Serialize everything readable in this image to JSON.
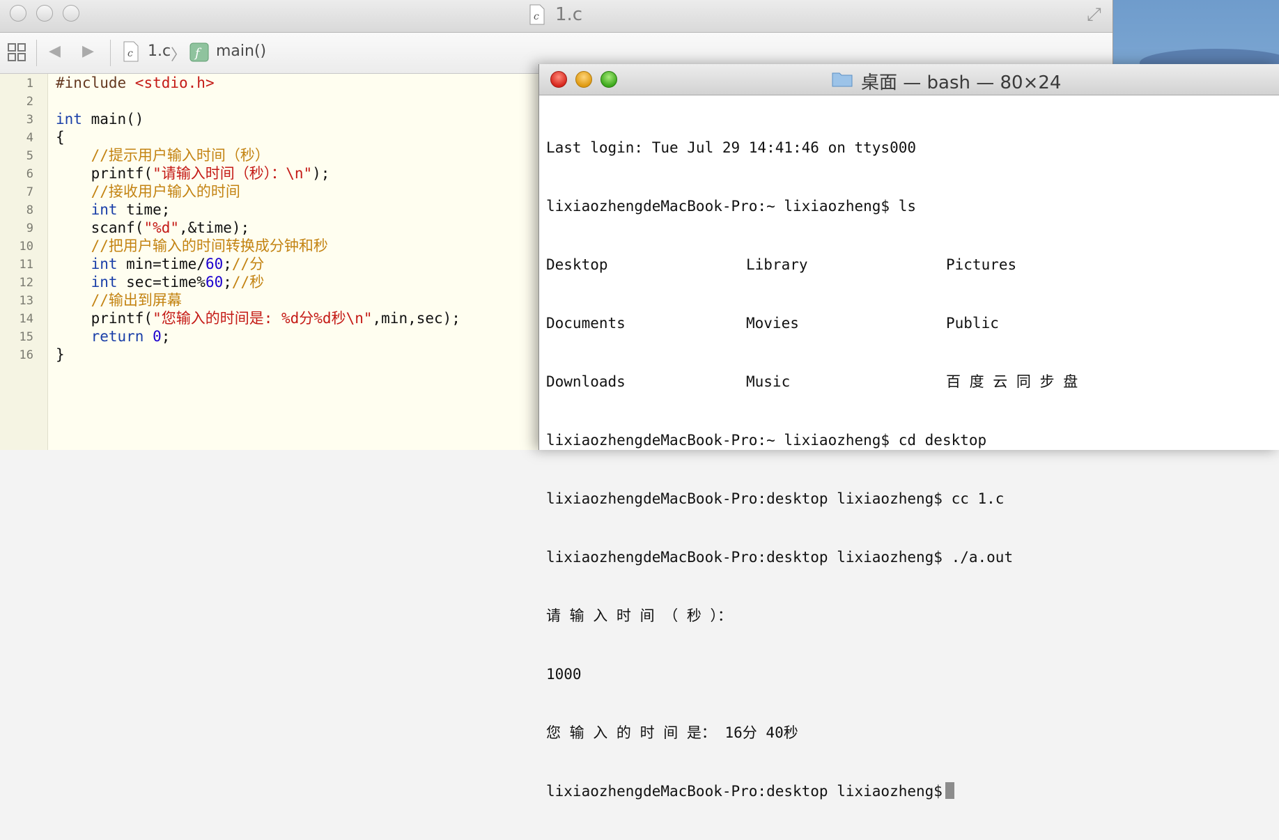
{
  "xcode": {
    "window_title": "1.c",
    "jump_bar": {
      "file": "1.c",
      "separator": "〉",
      "function": "main()"
    },
    "line_numbers": [
      "1",
      "2",
      "3",
      "4",
      "5",
      "6",
      "7",
      "8",
      "9",
      "10",
      "11",
      "12",
      "13",
      "14",
      "15",
      "16"
    ],
    "code_lines": [
      [
        {
          "t": "#include ",
          "c": "pp"
        },
        {
          "t": "<stdio.h>",
          "c": "str"
        }
      ],
      [],
      [
        {
          "t": "int",
          "c": "kw"
        },
        {
          "t": " main()",
          "c": ""
        }
      ],
      [
        {
          "t": "{",
          "c": ""
        }
      ],
      [
        {
          "t": "    ",
          "c": ""
        },
        {
          "t": "//提示用户输入时间（秒）",
          "c": "cm"
        }
      ],
      [
        {
          "t": "    printf(",
          "c": ""
        },
        {
          "t": "\"请输入时间（秒）：\\n\"",
          "c": "str"
        },
        {
          "t": ");",
          "c": ""
        }
      ],
      [
        {
          "t": "    ",
          "c": ""
        },
        {
          "t": "//接收用户输入的时间",
          "c": "cm"
        }
      ],
      [
        {
          "t": "    ",
          "c": ""
        },
        {
          "t": "int",
          "c": "kw"
        },
        {
          "t": " time;",
          "c": ""
        }
      ],
      [
        {
          "t": "    scanf(",
          "c": ""
        },
        {
          "t": "\"%d\"",
          "c": "str"
        },
        {
          "t": ",&time);",
          "c": ""
        }
      ],
      [
        {
          "t": "    ",
          "c": ""
        },
        {
          "t": "//把用户输入的时间转换成分钟和秒",
          "c": "cm"
        }
      ],
      [
        {
          "t": "    ",
          "c": ""
        },
        {
          "t": "int",
          "c": "kw"
        },
        {
          "t": " min=time/",
          "c": ""
        },
        {
          "t": "60",
          "c": "num"
        },
        {
          "t": ";",
          "c": ""
        },
        {
          "t": "//分",
          "c": "cm"
        }
      ],
      [
        {
          "t": "    ",
          "c": ""
        },
        {
          "t": "int",
          "c": "kw"
        },
        {
          "t": " sec=time%",
          "c": ""
        },
        {
          "t": "60",
          "c": "num"
        },
        {
          "t": ";",
          "c": ""
        },
        {
          "t": "//秒",
          "c": "cm"
        }
      ],
      [
        {
          "t": "    ",
          "c": ""
        },
        {
          "t": "//输出到屏幕",
          "c": "cm"
        }
      ],
      [
        {
          "t": "    printf(",
          "c": ""
        },
        {
          "t": "\"您输入的时间是: %d分%d秒\\n\"",
          "c": "str"
        },
        {
          "t": ",min,sec);",
          "c": ""
        }
      ],
      [
        {
          "t": "    ",
          "c": ""
        },
        {
          "t": "return",
          "c": "kw"
        },
        {
          "t": " ",
          "c": ""
        },
        {
          "t": "0",
          "c": "num"
        },
        {
          "t": ";",
          "c": ""
        }
      ],
      [
        {
          "t": "}",
          "c": ""
        }
      ]
    ]
  },
  "terminal": {
    "title": "桌面 — bash — 80×24",
    "lines": {
      "login": "Last login: Tue Jul 29 14:41:46 on ttys000",
      "cmd_ls": "lixiaozhengdeMacBook-Pro:~ lixiaozheng$ ls",
      "cmd_cd": "lixiaozhengdeMacBook-Pro:~ lixiaozheng$ cd desktop",
      "cmd_cc": "lixiaozhengdeMacBook-Pro:desktop lixiaozheng$ cc 1.c",
      "cmd_run": "lixiaozhengdeMacBook-Pro:desktop lixiaozheng$ ./a.out",
      "prompt_text": "请 输 入 时 间 （ 秒 ）：",
      "input": "1000",
      "result": "您 输 入 的 时 间 是： 16分 40秒",
      "final_prompt": "lixiaozhengdeMacBook-Pro:desktop lixiaozheng$"
    },
    "ls_output": [
      [
        "Desktop",
        "Library",
        "Pictures"
      ],
      [
        "Documents",
        "Movies",
        "Public"
      ],
      [
        "Downloads",
        "Music",
        "百 度 云 同 步 盘"
      ]
    ]
  }
}
